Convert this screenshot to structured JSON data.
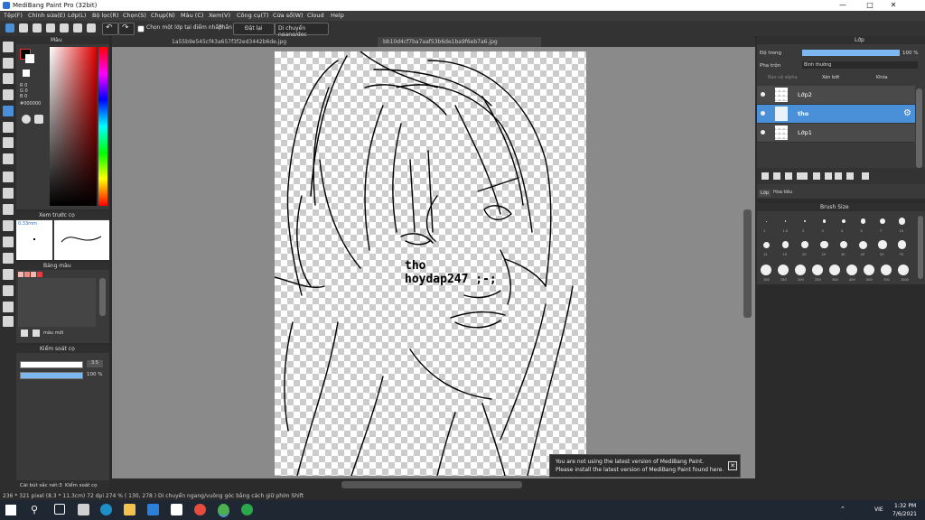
{
  "window": {
    "title": "MediBang Paint Pro (32bit)"
  },
  "menu": [
    "Tệp(F)",
    "Chỉnh sửa(E)",
    "Lớp(L)",
    "Bộ lọc(R)",
    "Chọn(S)",
    "Chụp(N)",
    "Màu (C)",
    "Xem(V)",
    "Công cụ(T)",
    "Cửa sổ(W)",
    "Cloud",
    "Help"
  ],
  "toolbar": {
    "snap_checkbox_label": "Chọn một lớp tại điểm nhấp",
    "snap_prefix": "Phần",
    "reset_label": "Đặt lại",
    "move_label": "Di chuyển ngang/dọc"
  },
  "tabs": [
    "1a55b9e545cf43a657f3f2ed3442b6de.jpg",
    "bb10d4cf7ba7aaf53b6de1ba9f6eb7a6.jpg"
  ],
  "color_panel": {
    "title": "Màu",
    "r": "R 0",
    "g": "G 0",
    "b": "B 0",
    "hex": "#000000"
  },
  "brush_preview": {
    "title": "Xem trước cọ",
    "size": "0.33mm"
  },
  "palette": {
    "title": "Bảng màu",
    "add_label": "màu mới"
  },
  "brush_control": {
    "title": "Kiểm soát cọ",
    "size_value": "3.5",
    "opacity_value": "100 %",
    "size_fill": 0.85,
    "opacity_fill": 1.0
  },
  "layer_panel": {
    "title": "Lớp",
    "opacity_label": "Độ trong",
    "opacity_value": "100 %",
    "opacity_fill": 1.0,
    "blend_label": "Pha trộn",
    "blend_value": "Bình thường",
    "protect_alpha": "Bảo vệ alpha",
    "clipping": "Xén bớt",
    "lock": "Khóa"
  },
  "layers": [
    {
      "name": "Lớp2",
      "selected": false
    },
    {
      "name": "tho",
      "selected": true
    },
    {
      "name": "Lớp1",
      "selected": false
    }
  ],
  "layer_tabs": [
    "Lớp",
    "Hoa tiêu"
  ],
  "brush_size": {
    "title": "Brush Size",
    "rows": [
      [
        "1",
        "1.5",
        "2",
        "3",
        "4",
        "5",
        "7",
        "10"
      ],
      [
        "12",
        "15",
        "20",
        "25",
        "30",
        "40",
        "50",
        "70"
      ],
      [
        "100",
        "150",
        "200",
        "250",
        "300",
        "400",
        "500",
        "700",
        "1000"
      ]
    ]
  },
  "canvas_text": {
    "line1": "tho",
    "line2": "hoydap247 ;-;"
  },
  "notice": {
    "line1": "You are not using the latest version of MediBang Paint.",
    "line2": "Please install the latest version of MediBang Paint found here."
  },
  "left_bottom_tabs": [
    "Cài bút sắc nét:3",
    "Kiểm soát cọ"
  ],
  "status": "236 * 321 pixel  (8.3 * 11.3cm)  72 dpi  274 %  ( 130, 278 )  Di chuyển ngang/vuông góc bằng cách giữ phím Shift",
  "taskbar": {
    "time": "1:32 PM",
    "date": "7/6/2021",
    "lang": "VIE"
  }
}
